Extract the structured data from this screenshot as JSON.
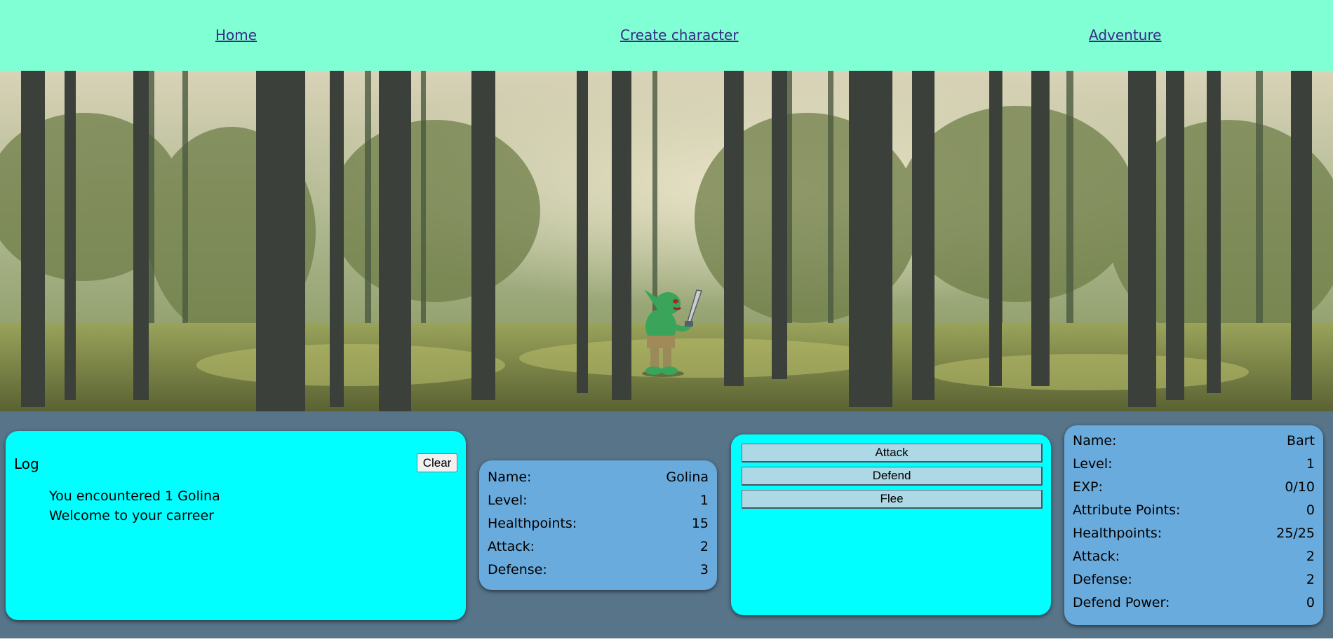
{
  "nav": {
    "links": [
      {
        "label": "Home"
      },
      {
        "label": "Create character"
      },
      {
        "label": "Adventure"
      }
    ]
  },
  "scene": {
    "background": "forest",
    "enemy_sprite": "goblin-with-sword"
  },
  "log": {
    "title": "Log",
    "clear_label": "Clear",
    "entries": [
      "You encountered 1 Golina",
      "Welcome to your carreer"
    ]
  },
  "enemy": {
    "stats": [
      {
        "label": "Name:",
        "value": "Golina"
      },
      {
        "label": "Level:",
        "value": "1"
      },
      {
        "label": "Healthpoints:",
        "value": "15"
      },
      {
        "label": "Attack:",
        "value": "2"
      },
      {
        "label": "Defense:",
        "value": "3"
      }
    ]
  },
  "actions": {
    "buttons": [
      {
        "label": "Attack"
      },
      {
        "label": "Defend"
      },
      {
        "label": "Flee"
      }
    ]
  },
  "player": {
    "stats": [
      {
        "label": "Name:",
        "value": "Bart"
      },
      {
        "label": "Level:",
        "value": "1"
      },
      {
        "label": "EXP:",
        "value": "0/10"
      },
      {
        "label": "Attribute Points:",
        "value": "0"
      },
      {
        "label": "Healthpoints:",
        "value": "25/25"
      },
      {
        "label": "Attack:",
        "value": "2"
      },
      {
        "label": "Defense:",
        "value": "2"
      },
      {
        "label": "Defend Power:",
        "value": "0"
      }
    ]
  },
  "colors": {
    "nav_bg": "#80ffd4",
    "panel_area_bg": "#577489",
    "cyan_card": "#00ffff",
    "blue_card": "#6aabdd",
    "action_button": "#add8e6"
  }
}
